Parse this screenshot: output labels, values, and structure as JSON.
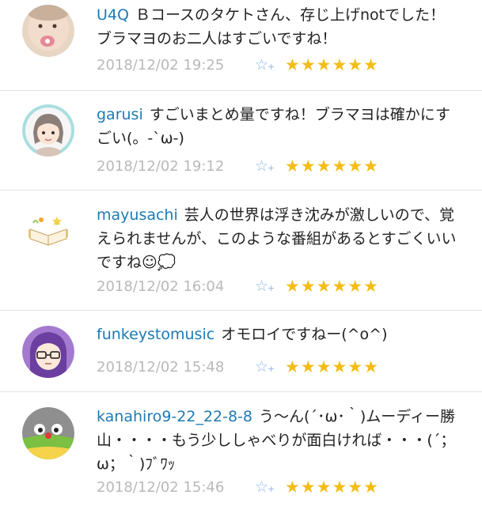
{
  "comments": [
    {
      "user": "U4Q",
      "text": "Ｂコースのタケトさん、存じ上げnotでした！ブラマヨのお二人はすごいですね！",
      "timestamp": "2018/12/02 19:25",
      "add_star": "☆",
      "add_star_plus": "+",
      "stars": "★★★★★★",
      "star_count": 6
    },
    {
      "user": "garusi",
      "text": "すごいまとめ量ですね！ブラマヨは確かにすごい(。-`ω-)",
      "timestamp": "2018/12/02 19:12",
      "add_star": "☆",
      "add_star_plus": "+",
      "stars": "★★★★★★",
      "star_count": 6
    },
    {
      "user": "mayusachi",
      "text": "芸人の世界は浮き沈みが激しいので、覚えられませんが、このような番組があるとすごくいいですね☺💭",
      "timestamp": "2018/12/02 16:04",
      "add_star": "☆",
      "add_star_plus": "+",
      "stars": "★★★★★★",
      "star_count": 6
    },
    {
      "user": "funkeystomusic",
      "text": "オモロイですねー(^o^)",
      "timestamp": "2018/12/02 15:48",
      "add_star": "☆",
      "add_star_plus": "+",
      "stars": "★★★★★★",
      "star_count": 6
    },
    {
      "user": "kanahiro9-22_22-8-8",
      "text": "う〜ん(´･ω･｀)ムーディー勝山・・・・もう少ししゃべりが面白ければ・・・(´；ω；｀)ﾌﾞﾜｯ",
      "timestamp": "2018/12/02 15:46",
      "add_star": "☆",
      "add_star_plus": "+",
      "stars": "★★★★★★",
      "star_count": 6
    }
  ]
}
